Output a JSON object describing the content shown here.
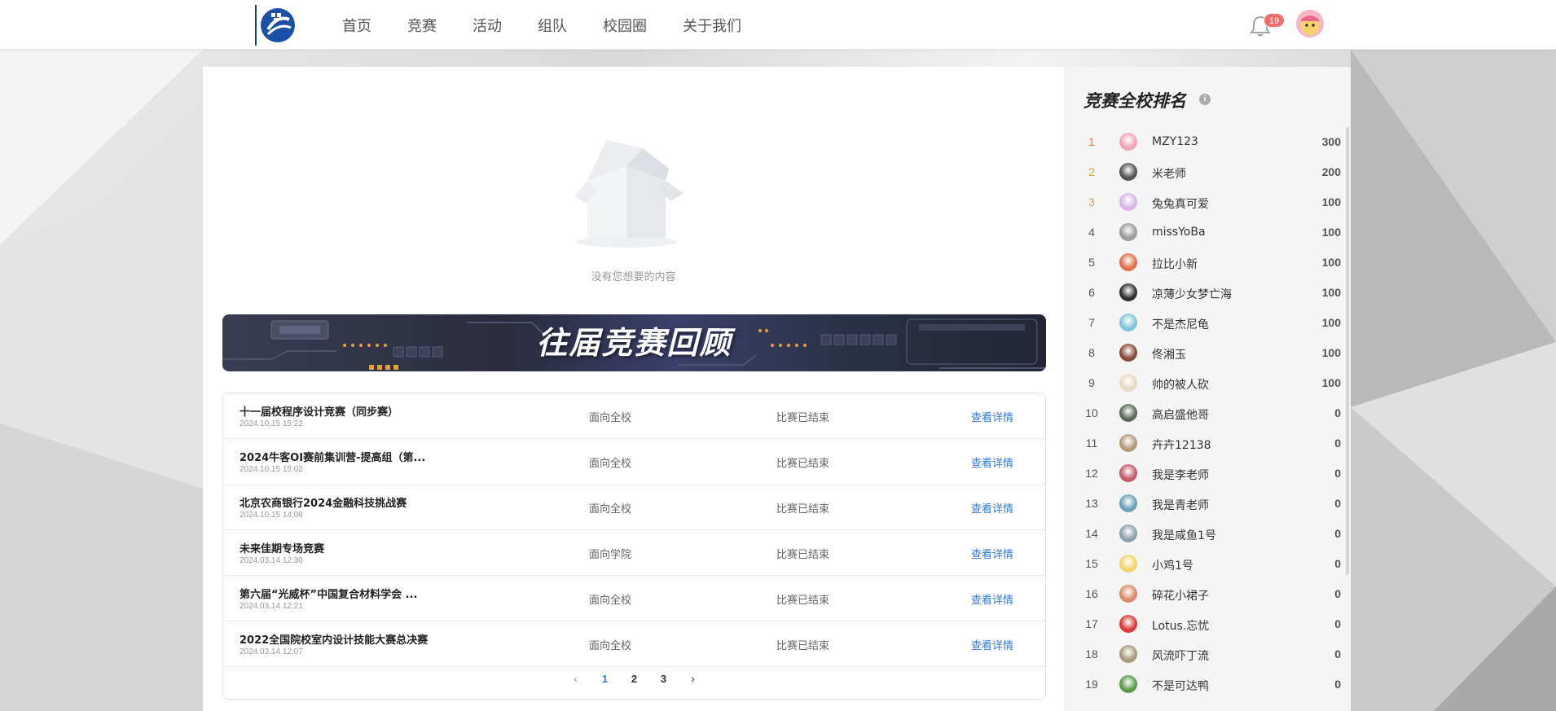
{
  "nav": {
    "items": [
      "首页",
      "竞赛",
      "活动",
      "组队",
      "校园圈",
      "关于我们"
    ]
  },
  "header": {
    "notification_count": "19",
    "icons": {
      "logo": "school-logo",
      "bell": "bell-icon",
      "avatar": "user-avatar"
    }
  },
  "main": {
    "empty_text": "没有您想要的内容",
    "banner_title": "往届竞赛回顾",
    "competitions": [
      {
        "title": "十一届校程序设计竞赛（同步赛）",
        "date": "2024.10.15 15:22",
        "scope": "面向全校",
        "status": "比赛已结束",
        "link": "查看详情"
      },
      {
        "title": "2024牛客OI赛前集训营-提高组（第...",
        "date": "2024.10.15 15:02",
        "scope": "面向全校",
        "status": "比赛已结束",
        "link": "查看详情"
      },
      {
        "title": "北京农商银行2024金融科技挑战赛",
        "date": "2024.10.15 14:08",
        "scope": "面向全校",
        "status": "比赛已结束",
        "link": "查看详情"
      },
      {
        "title": "未来佳期专场竞赛",
        "date": "2024.03.14 12:30",
        "scope": "面向学院",
        "status": "比赛已结束",
        "link": "查看详情"
      },
      {
        "title": "第六届“光威杯”中国复合材料学会 ...",
        "date": "2024.03.14 12:21",
        "scope": "面向全校",
        "status": "比赛已结束",
        "link": "查看详情"
      },
      {
        "title": "2022全国院校室内设计技能大赛总决赛",
        "date": "2024.03.14 12:07",
        "scope": "面向全校",
        "status": "比赛已结束",
        "link": "查看详情"
      }
    ],
    "pagination": {
      "prev": "‹",
      "pages": [
        "1",
        "2",
        "3"
      ],
      "current": "1",
      "next": "›"
    }
  },
  "ranking": {
    "title": "竞赛全校排名",
    "info_icon": "i",
    "rank_colors": {
      "1": "#e8793a",
      "2": "#e2a23a",
      "3": "#c9a06a"
    },
    "entries": [
      {
        "rank": "1",
        "name": "MZY123",
        "score": "300",
        "avatar_color": "#f4a3b5"
      },
      {
        "rank": "2",
        "name": "米老师",
        "score": "200",
        "avatar_color": "#555555"
      },
      {
        "rank": "3",
        "name": "兔兔真可爱",
        "score": "100",
        "avatar_color": "#d8b6e6"
      },
      {
        "rank": "4",
        "name": "missYoBa",
        "score": "100",
        "avatar_color": "#9a9a9a"
      },
      {
        "rank": "5",
        "name": "拉比小新",
        "score": "100",
        "avatar_color": "#e0714f"
      },
      {
        "rank": "6",
        "name": "凉薄少女梦亡海",
        "score": "100",
        "avatar_color": "#2f2f2f"
      },
      {
        "rank": "7",
        "name": "不是杰尼龟",
        "score": "100",
        "avatar_color": "#7cc7d9"
      },
      {
        "rank": "8",
        "name": "佟湘玉",
        "score": "100",
        "avatar_color": "#8a4a3a"
      },
      {
        "rank": "9",
        "name": "帅的被人砍",
        "score": "100",
        "avatar_color": "#e9d9c4"
      },
      {
        "rank": "10",
        "name": "高启盛他哥",
        "score": "0",
        "avatar_color": "#5a6a5a"
      },
      {
        "rank": "11",
        "name": "卉卉12138",
        "score": "0",
        "avatar_color": "#b59a7a"
      },
      {
        "rank": "12",
        "name": "我是李老师",
        "score": "0",
        "avatar_color": "#c45a6a"
      },
      {
        "rank": "13",
        "name": "我是青老师",
        "score": "0",
        "avatar_color": "#6aa0b8"
      },
      {
        "rank": "14",
        "name": "我是咸鱼1号",
        "score": "0",
        "avatar_color": "#8aa0b0"
      },
      {
        "rank": "15",
        "name": "小鸡1号",
        "score": "0",
        "avatar_color": "#f3d36a"
      },
      {
        "rank": "16",
        "name": "碎花小裙子",
        "score": "0",
        "avatar_color": "#d98a6a"
      },
      {
        "rank": "17",
        "name": "Lotus.忘忧",
        "score": "0",
        "avatar_color": "#d93a3a"
      },
      {
        "rank": "18",
        "name": "风流吓丁流",
        "score": "0",
        "avatar_color": "#a89a7a"
      },
      {
        "rank": "19",
        "name": "不是可达鸭",
        "score": "0",
        "avatar_color": "#5a9a4a"
      }
    ]
  }
}
